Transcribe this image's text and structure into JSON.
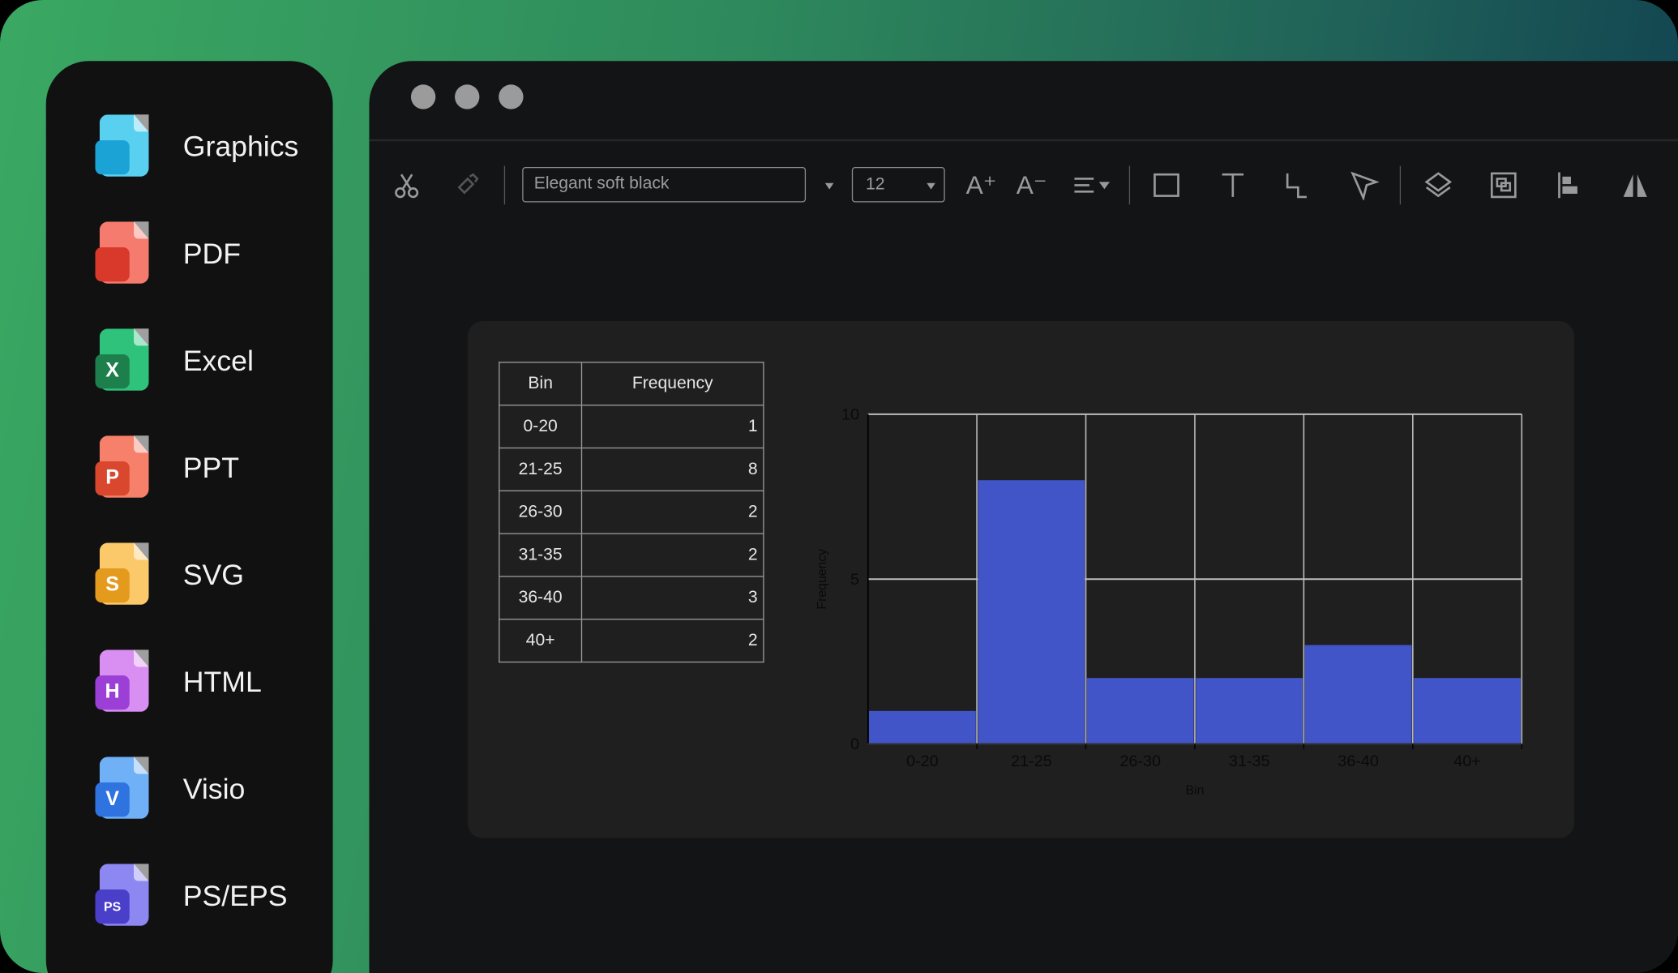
{
  "sidebar": {
    "items": [
      {
        "label": "Graphics",
        "icon": "image-file-icon",
        "badge": "",
        "color": "#5ad0f0",
        "badge_color": "#1ba3d6"
      },
      {
        "label": "PDF",
        "icon": "pdf-file-icon",
        "badge": "",
        "color": "#f47b6e",
        "badge_color": "#d8392b"
      },
      {
        "label": "Excel",
        "icon": "excel-file-icon",
        "badge": "X",
        "color": "#2ec27a",
        "badge_color": "#1d7f4c"
      },
      {
        "label": "PPT",
        "icon": "ppt-file-icon",
        "badge": "P",
        "color": "#f6806a",
        "badge_color": "#d9472f"
      },
      {
        "label": "SVG",
        "icon": "svg-file-icon",
        "badge": "S",
        "color": "#fbc96a",
        "badge_color": "#e39a1d"
      },
      {
        "label": "HTML",
        "icon": "html-file-icon",
        "badge": "H",
        "color": "#d98ef2",
        "badge_color": "#9c3fd6"
      },
      {
        "label": "Visio",
        "icon": "visio-file-icon",
        "badge": "V",
        "color": "#6fb0f7",
        "badge_color": "#2f73e0"
      },
      {
        "label": "PS/EPS",
        "icon": "ps-file-icon",
        "badge": "PS",
        "color": "#8d87f2",
        "badge_color": "#4a3fc9"
      }
    ]
  },
  "toolbar": {
    "font": "Elegant soft black",
    "size": "12"
  },
  "table": {
    "headers": [
      "Bin",
      "Frequency"
    ],
    "rows": [
      [
        "0-20",
        "1"
      ],
      [
        "21-25",
        "8"
      ],
      [
        "26-30",
        "2"
      ],
      [
        "31-35",
        "2"
      ],
      [
        "36-40",
        "3"
      ],
      [
        "40+",
        "2"
      ]
    ]
  },
  "chart_data": {
    "type": "bar",
    "categories": [
      "0-20",
      "21-25",
      "26-30",
      "31-35",
      "36-40",
      "40+"
    ],
    "values": [
      1,
      8,
      2,
      2,
      3,
      2
    ],
    "xlabel": "Bin",
    "ylabel": "Frequency",
    "ylim": [
      0,
      10
    ],
    "yticks": [
      "0",
      "5",
      "10"
    ],
    "grid": true,
    "bar_color": "#4255c8"
  }
}
